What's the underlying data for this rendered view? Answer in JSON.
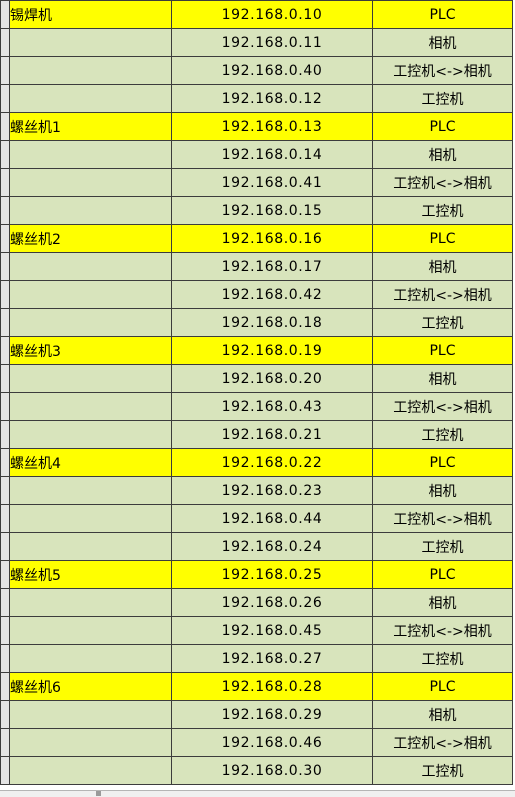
{
  "sheet": {
    "header_row": [
      "",
      "",
      ""
    ],
    "rows": [
      {
        "name": "锡焊机",
        "ip": "192.168.0.10",
        "device": "PLC",
        "highlight": true
      },
      {
        "name": "",
        "ip": "192.168.0.11",
        "device": "相机",
        "highlight": false
      },
      {
        "name": "",
        "ip": "192.168.0.40",
        "device": "工控机<->相机",
        "highlight": false
      },
      {
        "name": "",
        "ip": "192.168.0.12",
        "device": "工控机",
        "highlight": false
      },
      {
        "name": "螺丝机1",
        "ip": "192.168.0.13",
        "device": "PLC",
        "highlight": true
      },
      {
        "name": "",
        "ip": "192.168.0.14",
        "device": "相机",
        "highlight": false
      },
      {
        "name": "",
        "ip": "192.168.0.41",
        "device": "工控机<->相机",
        "highlight": false
      },
      {
        "name": "",
        "ip": "192.168.0.15",
        "device": "工控机",
        "highlight": false
      },
      {
        "name": "螺丝机2",
        "ip": "192.168.0.16",
        "device": "PLC",
        "highlight": true
      },
      {
        "name": "",
        "ip": "192.168.0.17",
        "device": "相机",
        "highlight": false
      },
      {
        "name": "",
        "ip": "192.168.0.42",
        "device": "工控机<->相机",
        "highlight": false
      },
      {
        "name": "",
        "ip": "192.168.0.18",
        "device": "工控机",
        "highlight": false
      },
      {
        "name": "螺丝机3",
        "ip": "192.168.0.19",
        "device": "PLC",
        "highlight": true
      },
      {
        "name": "",
        "ip": "192.168.0.20",
        "device": "相机",
        "highlight": false
      },
      {
        "name": "",
        "ip": "192.168.0.43",
        "device": "工控机<->相机",
        "highlight": false
      },
      {
        "name": "",
        "ip": "192.168.0.21",
        "device": "工控机",
        "highlight": false
      },
      {
        "name": "螺丝机4",
        "ip": "192.168.0.22",
        "device": "PLC",
        "highlight": true
      },
      {
        "name": "",
        "ip": "192.168.0.23",
        "device": "相机",
        "highlight": false
      },
      {
        "name": "",
        "ip": "192.168.0.44",
        "device": "工控机<->相机",
        "highlight": false
      },
      {
        "name": "",
        "ip": "192.168.0.24",
        "device": "工控机",
        "highlight": false
      },
      {
        "name": "螺丝机5",
        "ip": "192.168.0.25",
        "device": "PLC",
        "highlight": true
      },
      {
        "name": "",
        "ip": "192.168.0.26",
        "device": "相机",
        "highlight": false
      },
      {
        "name": "",
        "ip": "192.168.0.45",
        "device": "工控机<->相机",
        "highlight": false
      },
      {
        "name": "",
        "ip": "192.168.0.27",
        "device": "工控机",
        "highlight": false
      },
      {
        "name": "螺丝机6",
        "ip": "192.168.0.28",
        "device": "PLC",
        "highlight": true
      },
      {
        "name": "",
        "ip": "192.168.0.29",
        "device": "相机",
        "highlight": false
      },
      {
        "name": "",
        "ip": "192.168.0.46",
        "device": "工控机<->相机",
        "highlight": false
      },
      {
        "name": "",
        "ip": "192.168.0.30",
        "device": "工控机",
        "highlight": false
      }
    ]
  },
  "colors": {
    "cell_fill": "#d8e4bc",
    "highlight_fill": "#ffff00",
    "gridline": "#3c3c3c"
  }
}
